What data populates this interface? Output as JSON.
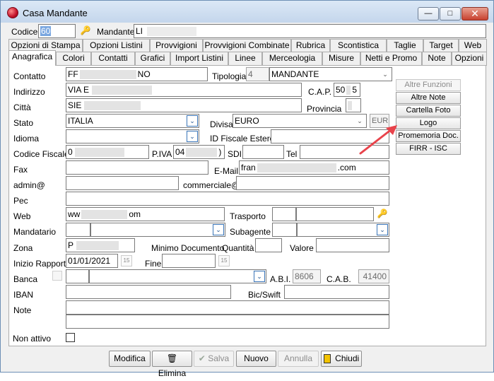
{
  "window": {
    "title": "Casa Mandante",
    "min_label": "—",
    "max_label": "□",
    "close_label": "✕"
  },
  "header": {
    "codice_label": "Codice",
    "codice_value": "60",
    "mandante_label": "Mandante",
    "mandante_value": "LI"
  },
  "tabs_row1": [
    "Opzioni di Stampa",
    "Opzioni Listini",
    "Provvigioni",
    "Provvigioni Combinate",
    "Rubrica",
    "Scontistica",
    "Taglie",
    "Target",
    "Web"
  ],
  "tabs_row2": [
    "Anagrafica",
    "Colori",
    "Contatti",
    "Grafici",
    "Import Listini",
    "Linee",
    "Merceologia",
    "Misure",
    "Netti e Promo",
    "Note",
    "Opzioni"
  ],
  "form": {
    "contatto_label": "Contatto",
    "contatto_value": "FF",
    "contatto_tail": "NO",
    "tipologia_label": "Tipologia",
    "tipologia_code": "4",
    "tipologia_value": "MANDANTE",
    "indirizzo_label": "Indirizzo",
    "indirizzo_value": "VIA E",
    "cap_label": "C.A.P.",
    "cap_value_a": "50",
    "cap_value_b": "5",
    "citta_label": "Città",
    "citta_value": "SIE",
    "provincia_label": "Provincia",
    "stato_label": "Stato",
    "stato_value": "ITALIA",
    "divisa_label": "Divisa",
    "divisa_value": "EURO",
    "divisa_code": "EUR",
    "idioma_label": "Idioma",
    "id_fiscale_label": "ID Fiscale Estero",
    "codice_fiscale_label": "Codice Fiscale",
    "codice_fiscale_value": "0",
    "piva_label": "P.IVA",
    "piva_value": "04",
    "piva_tail": ")",
    "sdi_label": "SDI",
    "tel_label": "Tel",
    "fax_label": "Fax",
    "email_label": "E-Mail",
    "email_value": "fran",
    "email_tail": ".com",
    "admin_label": "admin@",
    "commerciale_label": "commerciale@",
    "pec_label": "Pec",
    "web_label": "Web",
    "web_value": "ww",
    "web_tail": "om",
    "trasporto_label": "Trasporto",
    "mandatario_label": "Mandatario",
    "subagente_label": "Subagente",
    "zona_label": "Zona",
    "zona_value": "P",
    "minimo_label": "Minimo Documento",
    "quantita_label": "Quantità",
    "valore_label": "Valore",
    "inizio_label": "Inizio Rapporto",
    "inizio_value": "01/01/2021",
    "fine_label": "Fine",
    "cal_label": "15",
    "banca_label": "Banca",
    "abi_label": "A.B.I.",
    "abi_value": "8606",
    "cab_label": "C.A.B.",
    "cab_value": "41400",
    "iban_label": "IBAN",
    "bic_label": "Bic/Swift",
    "note_label": "Note",
    "non_attivo_label": "Non attivo"
  },
  "side_buttons": {
    "altre_funzioni": "Altre Funzioni",
    "altre_note": "Altre Note",
    "cartella_foto": "Cartella Foto",
    "logo": "Logo",
    "promemoria": "Promemoria  Doc.",
    "firr": "FIRR - ISC"
  },
  "footer": {
    "modifica": "Modifica",
    "elimina": "Elimina",
    "salva": "Salva",
    "nuovo": "Nuovo",
    "annulla": "Annulla",
    "chiudi": "Chiudi"
  },
  "colors": {
    "annotation_arrow": "#e8434b",
    "field_highlight": "#7aa7e0"
  }
}
